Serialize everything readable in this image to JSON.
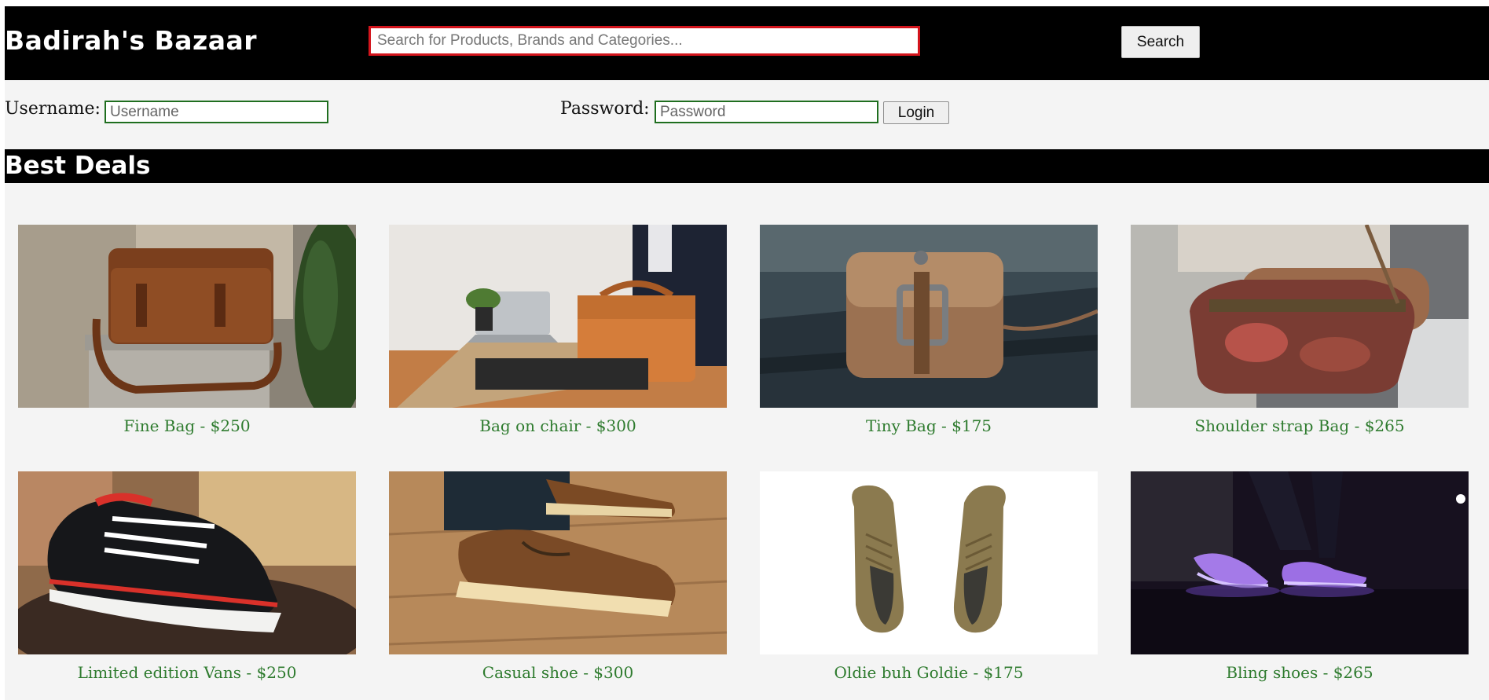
{
  "brand": {
    "name": "Badirah's Bazaar"
  },
  "search": {
    "placeholder": "Search for Products, Brands and Categories...",
    "value": "",
    "button_label": "Search"
  },
  "login": {
    "username_label": "Username:",
    "username_placeholder": "Username",
    "password_label": "Password:",
    "password_placeholder": "Password",
    "button_label": "Login"
  },
  "section": {
    "title": "Best Deals"
  },
  "colors": {
    "header_bg": "#000000",
    "page_bg": "#f4f4f4",
    "search_border": "#d3141c",
    "field_border": "#1f6e1f",
    "caption_text": "#2e7b2e"
  },
  "products": [
    {
      "caption": "Fine Bag - $250",
      "image": "brown-leather-satchel-photo"
    },
    {
      "caption": "Bag on chair - $300",
      "image": "man-with-laptop-and-tan-briefcase-photo"
    },
    {
      "caption": "Tiny Bag - $175",
      "image": "small-worn-leather-pouch-photo"
    },
    {
      "caption": "Shoulder strap Bag - $265",
      "image": "woman-with-patterned-shoulder-bag-photo"
    },
    {
      "caption": "Limited edition Vans - $250",
      "image": "black-red-vans-sneaker-photo"
    },
    {
      "caption": "Casual shoe - $300",
      "image": "brown-boat-shoes-on-wood-floor-photo"
    },
    {
      "caption": "Oldie buh Goldie - $175",
      "image": "khaki-suede-shoes-top-view-photo"
    },
    {
      "caption": "Bling shoes - $265",
      "image": "glowing-led-sneakers-photo"
    }
  ]
}
